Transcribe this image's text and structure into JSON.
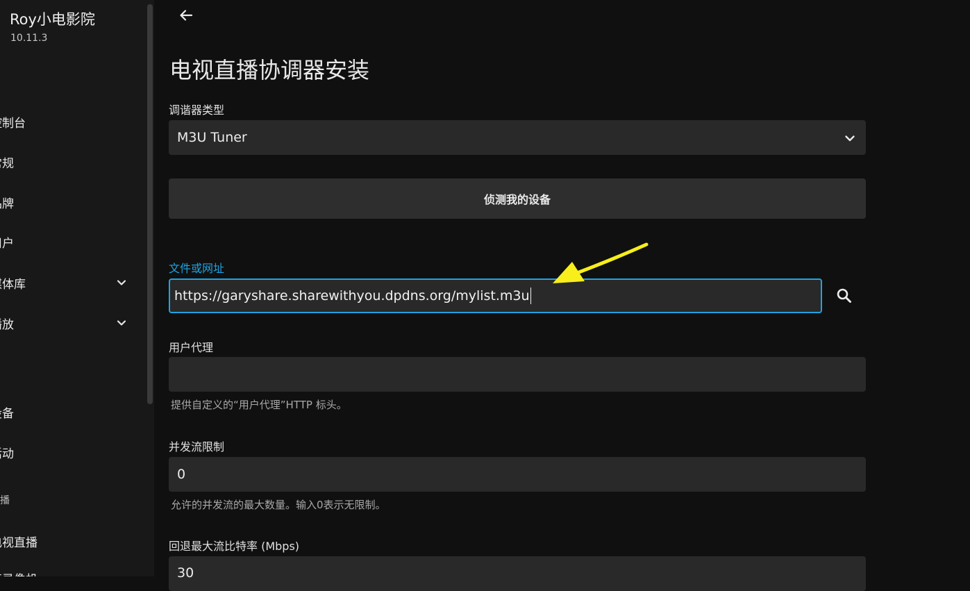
{
  "sidebar": {
    "app_title": "Roy小电影院",
    "app_version": "10.11.3",
    "items": [
      {
        "label": "控制台"
      },
      {
        "label": "常规"
      },
      {
        "label": "品牌"
      },
      {
        "label": "用户"
      },
      {
        "label": "媒体库"
      },
      {
        "label": "播放"
      },
      {
        "label": "设备"
      },
      {
        "label": "活动"
      },
      {
        "label": "电视直播"
      },
      {
        "label": "直录像机"
      }
    ],
    "section_live": "直播"
  },
  "page": {
    "title": "电视直播协调器安装",
    "back_icon": "arrow-left-icon"
  },
  "form": {
    "tuner_type": {
      "label": "调谐器类型",
      "value": "M3U Tuner",
      "icon": "chevron-down-icon"
    },
    "detect_button": "侦测我的设备",
    "file_url": {
      "label": "文件或网址",
      "value": "https://garyshare.sharewithyou.dpdns.org/mylist.m3u",
      "icon": "search-icon"
    },
    "user_agent": {
      "label": "用户代理",
      "value": "",
      "help": "提供自定义的“用户代理”HTTP 标头。"
    },
    "stream_limit": {
      "label": "并发流限制",
      "value": "0",
      "help": "允许的并发流的最大数量。输入0表示无限制。"
    },
    "fallback_bitrate": {
      "label": "回退最大流比特率 (Mbps)",
      "value": "30"
    }
  },
  "colors": {
    "accent": "#1da4e3",
    "annotation_arrow": "#f7ee1b",
    "background": "#101010",
    "sidebar": "#181818",
    "input": "#292929"
  }
}
